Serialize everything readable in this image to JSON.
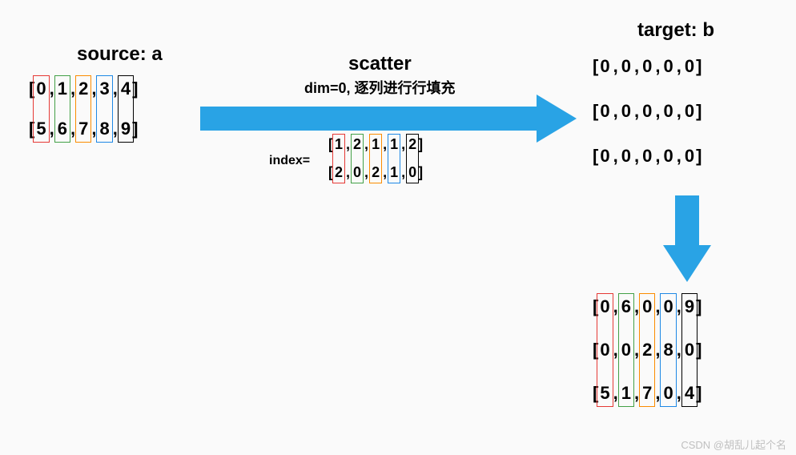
{
  "labels": {
    "source": "source: a",
    "scatter": "scatter",
    "scatter_sub": "dim=0, 逐列进行行填充",
    "index_eq": "index=",
    "target": "target: b"
  },
  "matrices": {
    "source": [
      [
        "0",
        "1",
        "2",
        "3",
        "4"
      ],
      [
        "5",
        "6",
        "7",
        "8",
        "9"
      ]
    ],
    "index": [
      [
        "1",
        "2",
        "1",
        "1",
        "2"
      ],
      [
        "2",
        "0",
        "2",
        "1",
        "0"
      ]
    ],
    "target_init": [
      [
        "0",
        "0",
        "0",
        "0",
        "0"
      ],
      [
        "0",
        "0",
        "0",
        "0",
        "0"
      ],
      [
        "0",
        "0",
        "0",
        "0",
        "0"
      ]
    ],
    "target_result": [
      [
        "0",
        "6",
        "0",
        "0",
        "9"
      ],
      [
        "0",
        "0",
        "2",
        "8",
        "0"
      ],
      [
        "5",
        "1",
        "7",
        "0",
        "4"
      ]
    ]
  },
  "colors": [
    "c-red",
    "c-green",
    "c-orange",
    "c-blue",
    "c-black"
  ],
  "watermark": "CSDN @胡乱儿起个名"
}
